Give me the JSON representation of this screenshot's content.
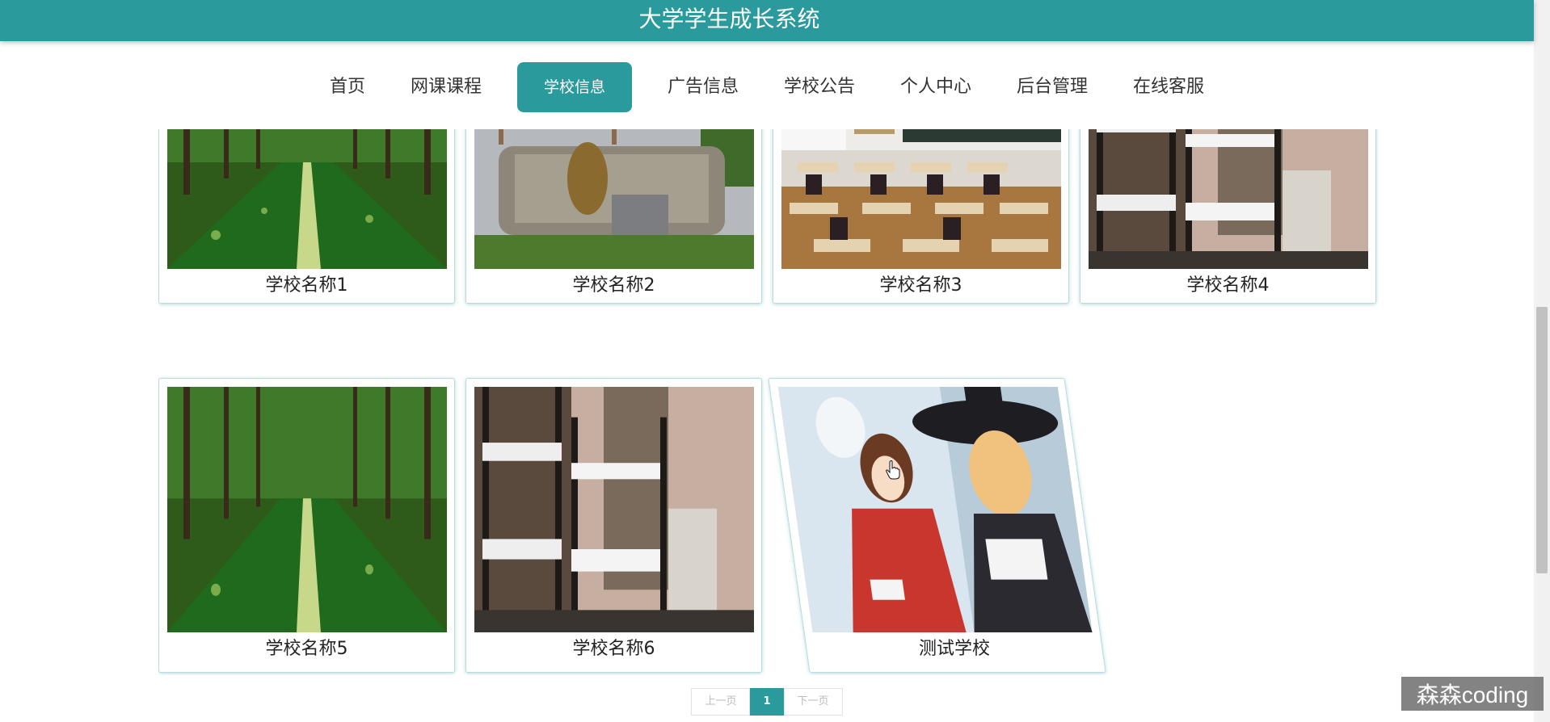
{
  "header": {
    "title": "大学学生成长系统",
    "bg_color": "#2b9a9c"
  },
  "nav": {
    "items": [
      {
        "label": "首页",
        "active": false
      },
      {
        "label": "网课课程",
        "active": false
      },
      {
        "label": "学校信息",
        "active": true
      },
      {
        "label": "广告信息",
        "active": false
      },
      {
        "label": "学校公告",
        "active": false
      },
      {
        "label": "个人中心",
        "active": false
      },
      {
        "label": "后台管理",
        "active": false
      },
      {
        "label": "在线客服",
        "active": false
      }
    ]
  },
  "schools": [
    {
      "name": "学校名称1",
      "image": "tree-lined-road-photo"
    },
    {
      "name": "学校名称2",
      "image": "statue-sculpture-photo"
    },
    {
      "name": "学校名称3",
      "image": "classroom-photo"
    },
    {
      "name": "学校名称4",
      "image": "dormitory-bunkbed-photo"
    },
    {
      "name": "学校名称5",
      "image": "tree-lined-road-photo"
    },
    {
      "name": "学校名称6",
      "image": "dormitory-bunkbed-photo"
    },
    {
      "name": "测试学校",
      "image": "anime-illustration-photo"
    }
  ],
  "pagination": {
    "prev": "上一页",
    "current": "1",
    "next": "下一页"
  },
  "watermark": "森森coding"
}
